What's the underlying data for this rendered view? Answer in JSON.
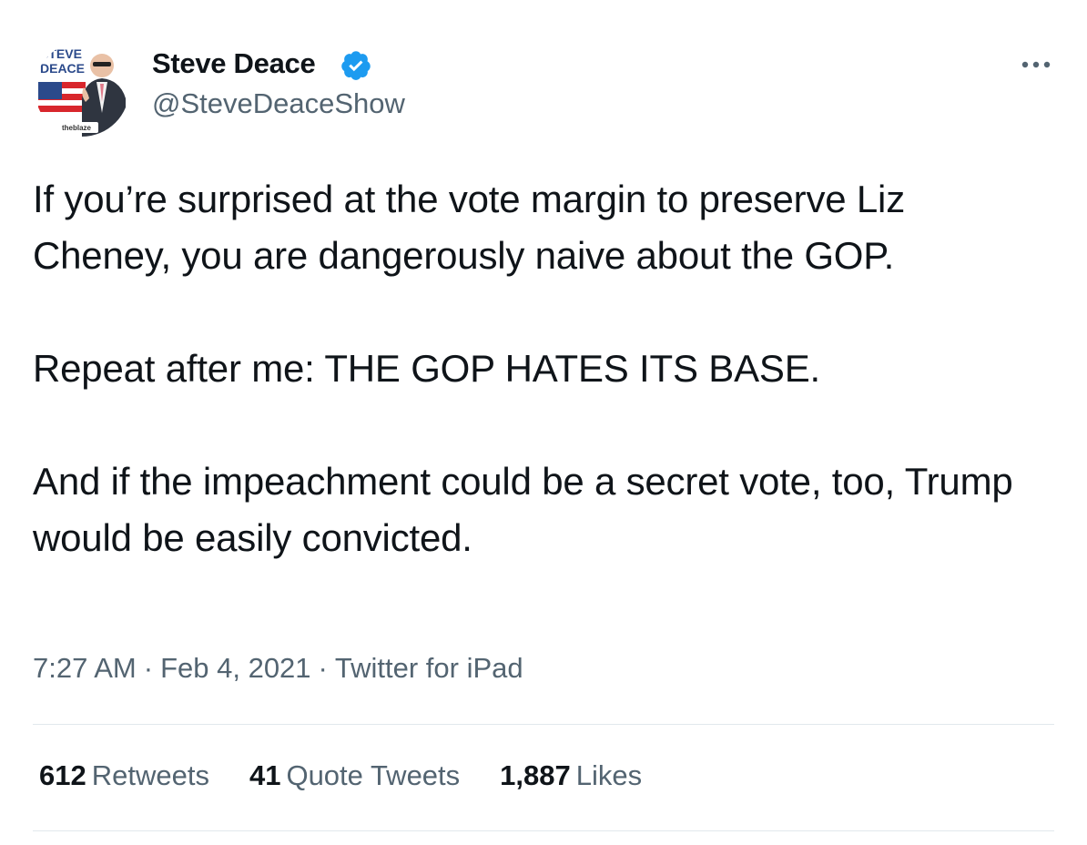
{
  "tweet": {
    "author": {
      "display_name": "Steve Deace",
      "handle": "@SteveDeaceShow",
      "verified": true,
      "avatar_logo_text": [
        "STEVE",
        "DEACE"
      ],
      "avatar_badge": "theblaze"
    },
    "text_paragraphs": [
      "If you’re surprised at the vote margin to preserve Liz Cheney, you are dangerously naive about the GOP.",
      "Repeat after me: THE GOP HATES ITS BASE.",
      "And if the impeachment could be a secret vote, too, Trump would be easily convicted."
    ],
    "time": "7:27 AM",
    "date": "Feb 4, 2021",
    "source": "Twitter for iPad",
    "separator": "·",
    "stats": {
      "retweets": {
        "count": "612",
        "label": "Retweets"
      },
      "quote_tweets": {
        "count": "41",
        "label": "Quote Tweets"
      },
      "likes": {
        "count": "1,887",
        "label": "Likes"
      }
    }
  },
  "icons": {
    "verified": "verified-badge-icon",
    "more": "more-options-icon"
  },
  "colors": {
    "text": "#0f1419",
    "secondary": "#536471",
    "verified_blue": "#1d9bf0",
    "divider": "#e1e8ed"
  }
}
